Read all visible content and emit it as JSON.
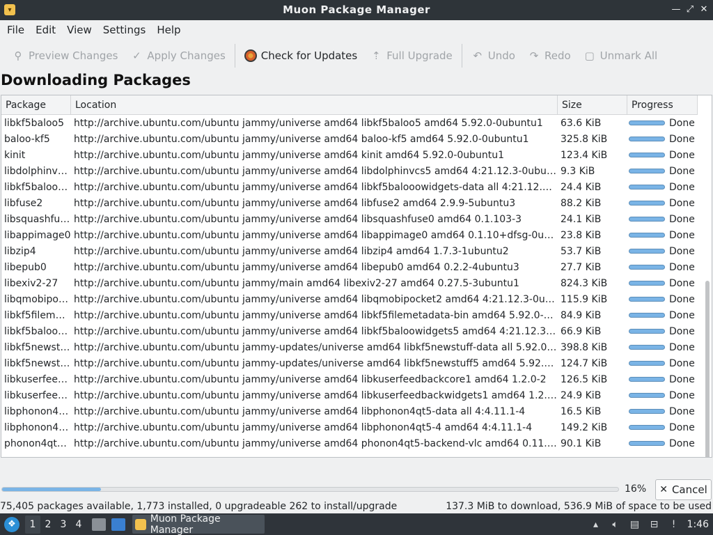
{
  "window": {
    "title": "Muon Package Manager"
  },
  "menu": [
    "File",
    "Edit",
    "View",
    "Settings",
    "Help"
  ],
  "toolbar": {
    "preview": "Preview Changes",
    "apply": "Apply Changes",
    "check_updates": "Check for Updates",
    "full_upgrade": "Full Upgrade",
    "undo": "Undo",
    "redo": "Redo",
    "unmark_all": "Unmark All"
  },
  "heading": "Downloading Packages",
  "table": {
    "columns": [
      "Package",
      "Location",
      "Size",
      "Progress"
    ],
    "rows": [
      {
        "pkg": "libkf5baloo5",
        "loc": "http://archive.ubuntu.com/ubuntu jammy/universe amd64 libkf5baloo5 amd64 5.92.0-0ubuntu1",
        "size": "63.6 KiB",
        "status": "Done"
      },
      {
        "pkg": "baloo-kf5",
        "loc": "http://archive.ubuntu.com/ubuntu jammy/universe amd64 baloo-kf5 amd64 5.92.0-0ubuntu1",
        "size": "325.8 KiB",
        "status": "Done"
      },
      {
        "pkg": "kinit",
        "loc": "http://archive.ubuntu.com/ubuntu jammy/universe amd64 kinit amd64 5.92.0-0ubuntu1",
        "size": "123.4 KiB",
        "status": "Done"
      },
      {
        "pkg": "libdolphinvcs5",
        "loc": "http://archive.ubuntu.com/ubuntu jammy/universe amd64 libdolphinvcs5 amd64 4:21.12.3-0ubuntu1",
        "size": "9.3 KiB",
        "status": "Done"
      },
      {
        "pkg": "libkf5baloo…",
        "loc": "http://archive.ubuntu.com/ubuntu jammy/universe amd64 libkf5balooowidgets-data all 4:21.12.3-0ub…",
        "size": "24.4 KiB",
        "status": "Done"
      },
      {
        "pkg": "libfuse2",
        "loc": "http://archive.ubuntu.com/ubuntu jammy/universe amd64 libfuse2 amd64 2.9.9-5ubuntu3",
        "size": "88.2 KiB",
        "status": "Done"
      },
      {
        "pkg": "libsquashfus…",
        "loc": "http://archive.ubuntu.com/ubuntu jammy/universe amd64 libsquashfuse0 amd64 0.1.103-3",
        "size": "24.1 KiB",
        "status": "Done"
      },
      {
        "pkg": "libappimage0",
        "loc": "http://archive.ubuntu.com/ubuntu jammy/universe amd64 libappimage0 amd64 0.1.10+dfsg-0ubuntu1",
        "size": "23.8 KiB",
        "status": "Done"
      },
      {
        "pkg": "libzip4",
        "loc": "http://archive.ubuntu.com/ubuntu jammy/universe amd64 libzip4 amd64 1.7.3-1ubuntu2",
        "size": "53.7 KiB",
        "status": "Done"
      },
      {
        "pkg": "libepub0",
        "loc": "http://archive.ubuntu.com/ubuntu jammy/universe amd64 libepub0 amd64 0.2.2-4ubuntu3",
        "size": "27.7 KiB",
        "status": "Done"
      },
      {
        "pkg": "libexiv2-27",
        "loc": "http://archive.ubuntu.com/ubuntu jammy/main amd64 libexiv2-27 amd64 0.27.5-3ubuntu1",
        "size": "824.3 KiB",
        "status": "Done"
      },
      {
        "pkg": "libqmobipoc…",
        "loc": "http://archive.ubuntu.com/ubuntu jammy/universe amd64 libqmobipocket2 amd64 4:21.12.3-0ubuntu1",
        "size": "115.9 KiB",
        "status": "Done"
      },
      {
        "pkg": "libkf5fileme…",
        "loc": "http://archive.ubuntu.com/ubuntu jammy/universe amd64 libkf5filemetadata-bin amd64 5.92.0-0ubu…",
        "size": "84.9 KiB",
        "status": "Done"
      },
      {
        "pkg": "libkf5baloo…",
        "loc": "http://archive.ubuntu.com/ubuntu jammy/universe amd64 libkf5baloowidgets5 amd64 4:21.12.3-0ub…",
        "size": "66.9 KiB",
        "status": "Done"
      },
      {
        "pkg": "libkf5newst…",
        "loc": "http://archive.ubuntu.com/ubuntu jammy-updates/universe amd64 libkf5newstuff-data all 5.92.0-0u…",
        "size": "398.8 KiB",
        "status": "Done"
      },
      {
        "pkg": "libkf5newst…",
        "loc": "http://archive.ubuntu.com/ubuntu jammy-updates/universe amd64 libkf5newstuff5 amd64 5.92.0-0u…",
        "size": "124.7 KiB",
        "status": "Done"
      },
      {
        "pkg": "libkuserfee…",
        "loc": "http://archive.ubuntu.com/ubuntu jammy/universe amd64 libkuserfeedbackcore1 amd64 1.2.0-2",
        "size": "126.5 KiB",
        "status": "Done"
      },
      {
        "pkg": "libkuserfee…",
        "loc": "http://archive.ubuntu.com/ubuntu jammy/universe amd64 libkuserfeedbackwidgets1 amd64 1.2.0-2",
        "size": "24.9 KiB",
        "status": "Done"
      },
      {
        "pkg": "libphonon4…",
        "loc": "http://archive.ubuntu.com/ubuntu jammy/universe amd64 libphonon4qt5-data all 4:4.11.1-4",
        "size": "16.5 KiB",
        "status": "Done"
      },
      {
        "pkg": "libphonon4…",
        "loc": "http://archive.ubuntu.com/ubuntu jammy/universe amd64 libphonon4qt5-4 amd64 4:4.11.1-4",
        "size": "149.2 KiB",
        "status": "Done"
      },
      {
        "pkg": "phonon4qt5…",
        "loc": "http://archive.ubuntu.com/ubuntu jammy/universe amd64 phonon4qt5-backend-vlc amd64 0.11.3-1",
        "size": "90.1 KiB",
        "status": "Done"
      }
    ]
  },
  "progress": {
    "percent_label": "16%",
    "fraction": 0.16,
    "cancel": "Cancel"
  },
  "status": {
    "left": "75,405 packages available, 1,773 installed, 0 upgradeable 262 to install/upgrade",
    "right": "137.3 MiB to download, 536.9 MiB of space to be used"
  },
  "taskbar": {
    "workspaces": [
      "1",
      "2",
      "3",
      "4"
    ],
    "task_label": "Muon Package Manager",
    "clock": "1:46"
  }
}
